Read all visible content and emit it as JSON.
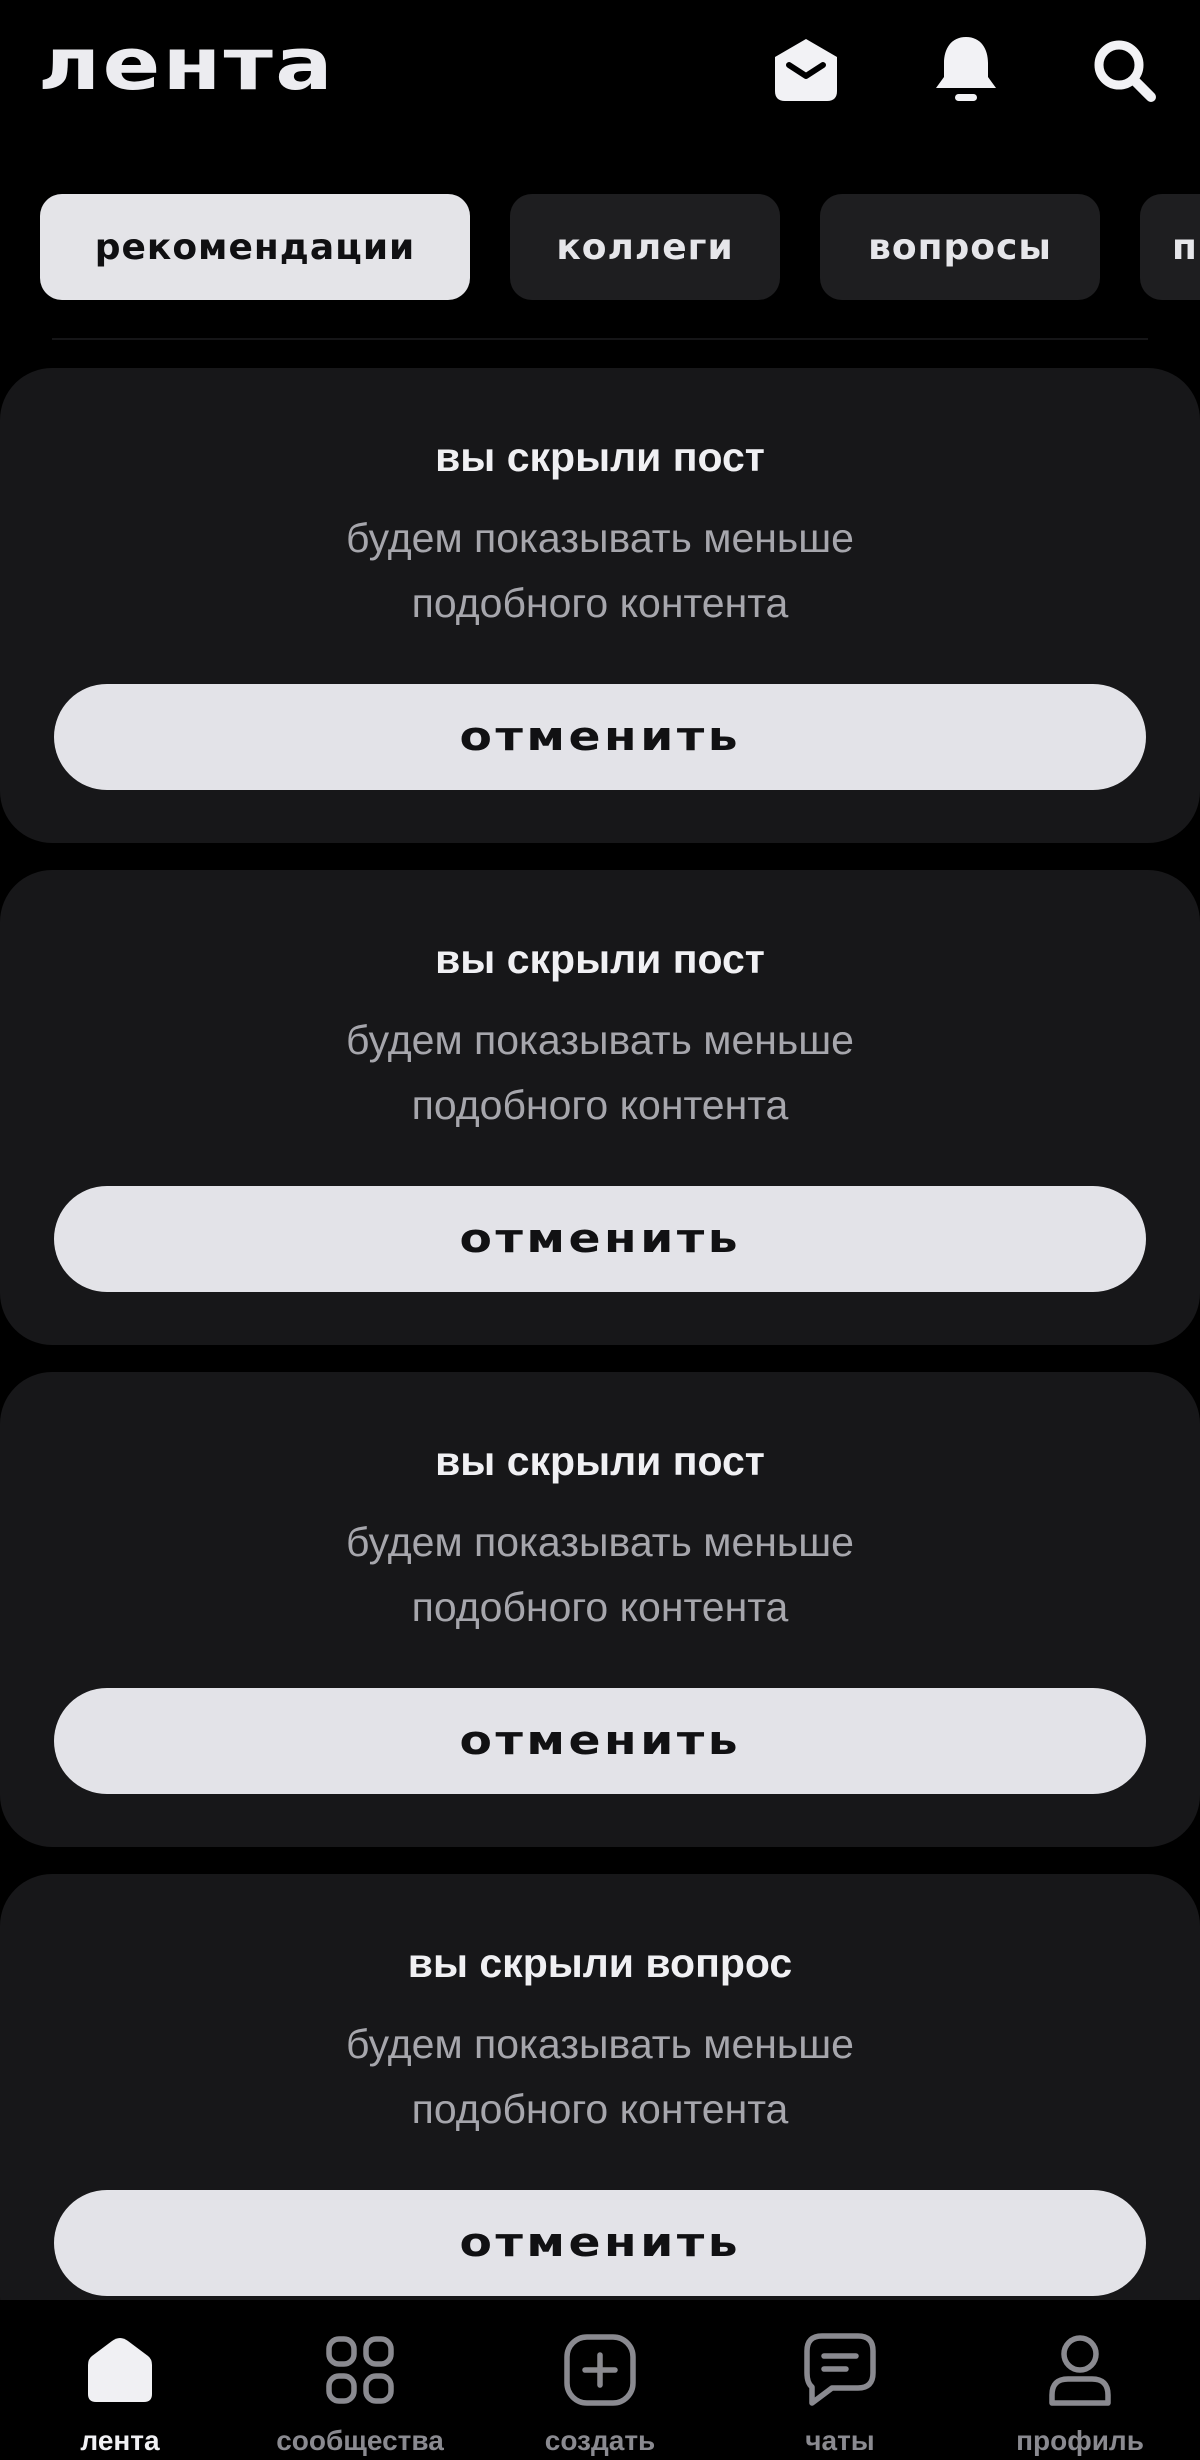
{
  "header": {
    "logo": "лента",
    "icons": [
      "mail-icon",
      "bell-icon",
      "search-icon"
    ]
  },
  "tabs": [
    {
      "label": "рекомендации",
      "active": true
    },
    {
      "label": "коллеги",
      "active": false
    },
    {
      "label": "вопросы",
      "active": false
    },
    {
      "label": "п",
      "active": false
    }
  ],
  "cards": [
    {
      "title": "вы скрыли пост",
      "subtitle_line1": "будем показывать меньше",
      "subtitle_line2": "подобного контента",
      "button": "отменить"
    },
    {
      "title": "вы скрыли пост",
      "subtitle_line1": "будем показывать меньше",
      "subtitle_line2": "подобного контента",
      "button": "отменить"
    },
    {
      "title": "вы скрыли пост",
      "subtitle_line1": "будем показывать меньше",
      "subtitle_line2": "подобного контента",
      "button": "отменить"
    },
    {
      "title": "вы скрыли вопрос",
      "subtitle_line1": "будем показывать меньше",
      "subtitle_line2": "подобного контента",
      "button": "отменить"
    }
  ],
  "bottom_nav": [
    {
      "label": "лента",
      "icon": "home-icon",
      "active": true
    },
    {
      "label": "сообщества",
      "icon": "grid-icon",
      "active": false
    },
    {
      "label": "создать",
      "icon": "plus-square-icon",
      "active": false
    },
    {
      "label": "чаты",
      "icon": "chat-icon",
      "active": false
    },
    {
      "label": "профиль",
      "icon": "user-icon",
      "active": false
    }
  ],
  "colors": {
    "background": "#000000",
    "card": "#171719",
    "tab": "#1e1e20",
    "tab_active": "#e4e4e8",
    "button": "#e3e3e8",
    "text_primary": "#f0f0f3",
    "text_secondary": "#a6a6ac",
    "nav_inactive": "#8a8a90"
  }
}
